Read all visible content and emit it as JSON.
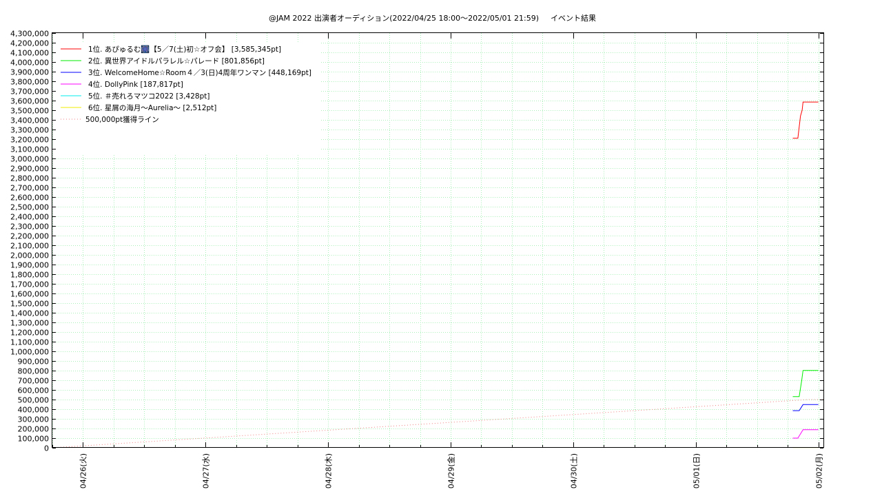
{
  "chart_data": {
    "type": "line",
    "title": "@JAM 2022 出演者オーディション(2022/04/25 18:00〜2022/05/01 21:59)",
    "subtitle": "イベント結果",
    "xlabel": "",
    "ylabel": "",
    "ylim": [
      0,
      4300000
    ],
    "y_tick_step": 100000,
    "xlim": [
      "2022-04-25 18:00",
      "2022-05-02 01:00"
    ],
    "x_ticks": [
      {
        "date": "2022-04-26 00:00",
        "label": "04/26(火)"
      },
      {
        "date": "2022-04-27 00:00",
        "label": "04/27(水)"
      },
      {
        "date": "2022-04-28 00:00",
        "label": "04/28(木)"
      },
      {
        "date": "2022-04-29 00:00",
        "label": "04/29(金)"
      },
      {
        "date": "2022-04-30 00:00",
        "label": "04/30(土)"
      },
      {
        "date": "2022-05-01 00:00",
        "label": "05/01(日)"
      },
      {
        "date": "2022-05-02 00:00",
        "label": "05/02(月)"
      }
    ],
    "grid": true,
    "legend_position": "top-left",
    "series": [
      {
        "name": "1位. あぴゅるむ🎆【5／7(土)初☆オフ会】 [3,585,345pt]",
        "color": "#ff0000",
        "style": "solid",
        "points": [
          [
            "2022-05-01 19:00",
            3210000
          ],
          [
            "2022-05-01 20:00",
            3210000
          ],
          [
            "2022-05-01 20:30",
            3440000
          ],
          [
            "2022-05-01 20:50",
            3500000
          ],
          [
            "2022-05-01 21:00",
            3585345
          ],
          [
            "2022-05-02 00:00",
            3585345
          ]
        ]
      },
      {
        "name": "2位. 異世界アイドルパラレル☆パレード [801,856pt]",
        "color": "#00ee00",
        "style": "solid",
        "points": [
          [
            "2022-05-01 19:00",
            530000
          ],
          [
            "2022-05-01 20:15",
            530000
          ],
          [
            "2022-05-01 20:45",
            700000
          ],
          [
            "2022-05-01 21:00",
            801856
          ],
          [
            "2022-05-02 00:00",
            801856
          ]
        ]
      },
      {
        "name": "3位. WelcomeHome☆Room４／3(日)4周年ワンマン [448,169pt]",
        "color": "#0000ff",
        "style": "solid",
        "points": [
          [
            "2022-05-01 19:00",
            385000
          ],
          [
            "2022-05-01 20:15",
            385000
          ],
          [
            "2022-05-01 21:00",
            448169
          ],
          [
            "2022-05-02 00:00",
            448169
          ]
        ]
      },
      {
        "name": "4位. DollyPink [187,817pt]",
        "color": "#ff00ff",
        "style": "solid",
        "points": [
          [
            "2022-05-01 19:00",
            100000
          ],
          [
            "2022-05-01 20:00",
            100000
          ],
          [
            "2022-05-01 21:00",
            187817
          ],
          [
            "2022-05-02 00:00",
            187817
          ]
        ]
      },
      {
        "name": "5位. ＃売れろマツコ2022 [3,428pt]",
        "color": "#00eeee",
        "style": "solid",
        "points": [
          [
            "2022-05-01 19:00",
            3428
          ],
          [
            "2022-05-02 00:00",
            3428
          ]
        ]
      },
      {
        "name": "6位. 星屑の海月〜Aurelia〜 [2,512pt]",
        "color": "#eeee00",
        "style": "solid",
        "points": [
          [
            "2022-05-01 19:00",
            2512
          ],
          [
            "2022-05-02 00:00",
            2512
          ]
        ]
      },
      {
        "name": "500,000pt獲得ライン",
        "color": "#f08080",
        "style": "dotted",
        "points": [
          [
            "2022-04-25 18:00",
            0
          ],
          [
            "2022-05-01 21:59",
            500000
          ],
          [
            "2022-05-02 01:00",
            500000
          ]
        ]
      }
    ]
  }
}
